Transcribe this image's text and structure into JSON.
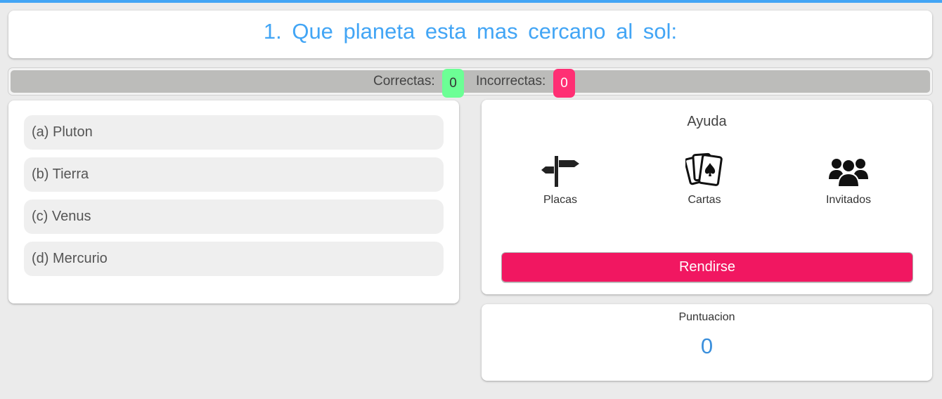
{
  "colors": {
    "accent": "#42a5f5",
    "correct_badge": "#6cff95",
    "incorrect_badge": "#ff2f74",
    "surrender_button": "#f11761"
  },
  "question": {
    "text": "1. Que planeta esta mas cercano al sol:"
  },
  "score": {
    "correct_label": "Correctas:",
    "correct_count": "0",
    "incorrect_label": "Incorrectas:",
    "incorrect_count": "0"
  },
  "answers": [
    {
      "label": "(a) Pluton"
    },
    {
      "label": "(b) Tierra"
    },
    {
      "label": "(c) Venus"
    },
    {
      "label": "(d) Mercurio"
    }
  ],
  "help": {
    "title": "Ayuda",
    "options": [
      {
        "label": "Placas",
        "icon": "signpost-icon"
      },
      {
        "label": "Cartas",
        "icon": "playing-cards-icon"
      },
      {
        "label": "Invitados",
        "icon": "users-group-icon"
      }
    ],
    "surrender_label": "Rendirse"
  },
  "points": {
    "label": "Puntuacion",
    "value": "0"
  }
}
